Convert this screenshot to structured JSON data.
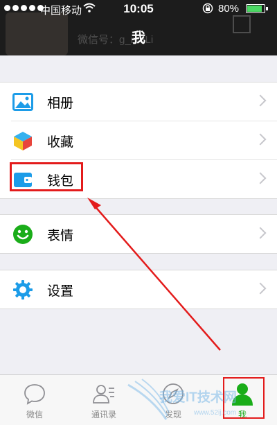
{
  "status_bar": {
    "carrier": "中国移动",
    "time": "10:05",
    "battery": "80%"
  },
  "nav": {
    "title": "我"
  },
  "profile_ghost": {
    "name": "",
    "wechat_id": "微信号：g_meLi"
  },
  "menu": {
    "groups": [
      [
        {
          "label": "相册",
          "icon": "photo-album-icon"
        },
        {
          "label": "收藏",
          "icon": "favorites-cube-icon"
        },
        {
          "label": "钱包",
          "icon": "wallet-icon"
        }
      ],
      [
        {
          "label": "表情",
          "icon": "smiley-icon"
        }
      ],
      [
        {
          "label": "设置",
          "icon": "gear-icon"
        }
      ]
    ]
  },
  "tabbar": {
    "tabs": [
      {
        "label": "微信",
        "icon": "chat-bubble-icon"
      },
      {
        "label": "通讯录",
        "icon": "contacts-icon"
      },
      {
        "label": "发现",
        "icon": "compass-icon"
      },
      {
        "label": "我",
        "icon": "person-icon",
        "active": true
      }
    ]
  },
  "watermark": {
    "text": "我爱IT技术网",
    "url": "www.52ij.com"
  },
  "colors": {
    "accent_green": "#1aad19",
    "highlight_red": "#e31b1b",
    "nav_bg": "#1c1c1c",
    "page_bg": "#efeff4"
  }
}
